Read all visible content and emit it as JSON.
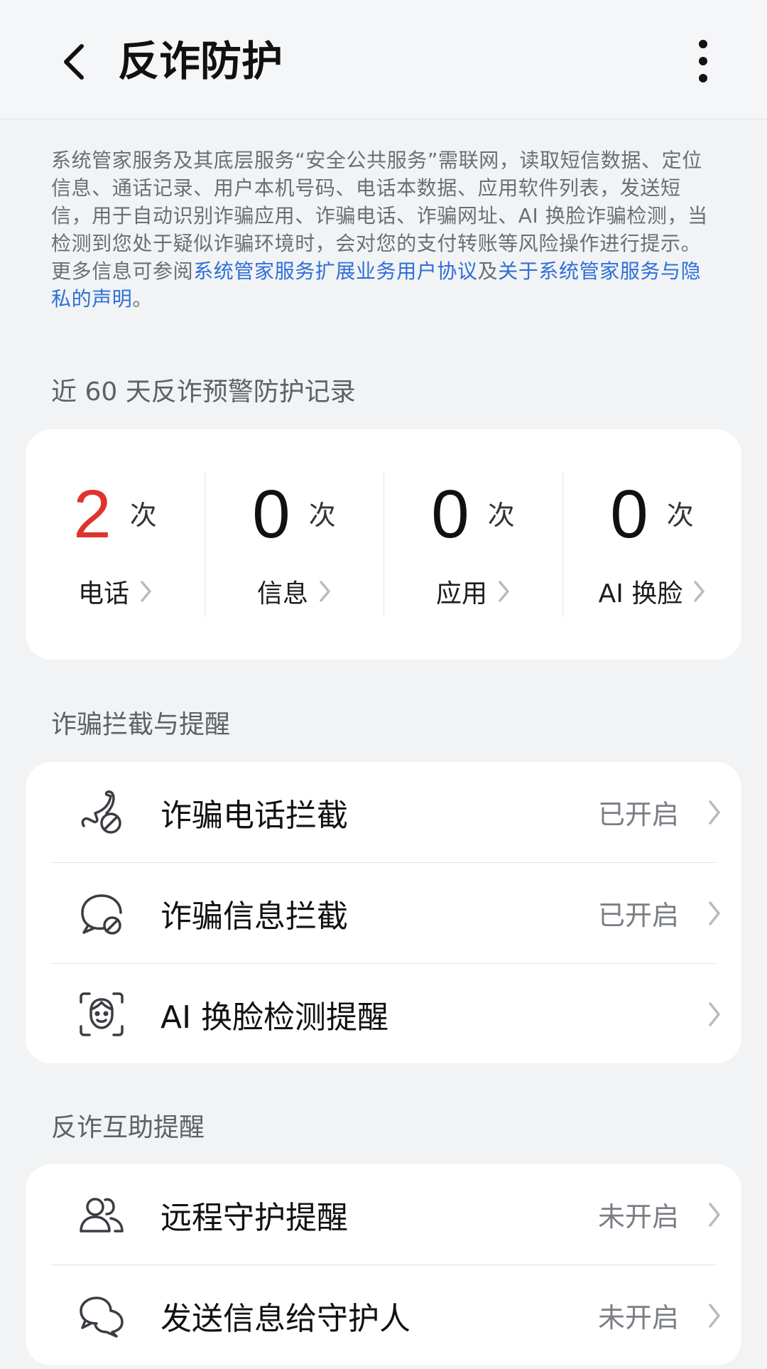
{
  "header": {
    "title": "反诈防护"
  },
  "notice": {
    "text_before": "系统管家服务及其底层服务“安全公共服务”需联网，读取短信数据、定位信息、通话记录、用户本机号码、电话本数据、应用软件列表，发送短信，用于自动识别诈骗应用、诈骗电话、诈骗网址、AI 换脸诈骗检测，当检测到您处于疑似诈骗环境时，会对您的支付转账等风险操作进行提示。更多信息可参阅",
    "link1": "系统管家服务扩展业务用户协议",
    "joiner": "及",
    "link2": "关于系统管家服务与隐私的声明",
    "end": "。"
  },
  "records": {
    "title": "近 60 天反诈预警防护记录",
    "unit": "次",
    "items": [
      {
        "value": "2",
        "label": "电话"
      },
      {
        "value": "0",
        "label": "信息"
      },
      {
        "value": "0",
        "label": "应用"
      },
      {
        "value": "0",
        "label": "AI 换脸"
      }
    ]
  },
  "intercept": {
    "title": "诈骗拦截与提醒",
    "rows": [
      {
        "label": "诈骗电话拦截",
        "status": "已开启",
        "icon": "phone-block-icon"
      },
      {
        "label": "诈骗信息拦截",
        "status": "已开启",
        "icon": "message-block-icon"
      },
      {
        "label": "AI 换脸检测提醒",
        "status": "",
        "icon": "face-scan-icon"
      }
    ]
  },
  "mutual": {
    "title": "反诈互助提醒",
    "rows": [
      {
        "label": "远程守护提醒",
        "status": "未开启",
        "icon": "people-icon"
      },
      {
        "label": "发送信息给守护人",
        "status": "未开启",
        "icon": "chat-bubbles-icon"
      }
    ]
  },
  "colors": {
    "alert": "#e0332f",
    "link": "#2f6fd6"
  }
}
